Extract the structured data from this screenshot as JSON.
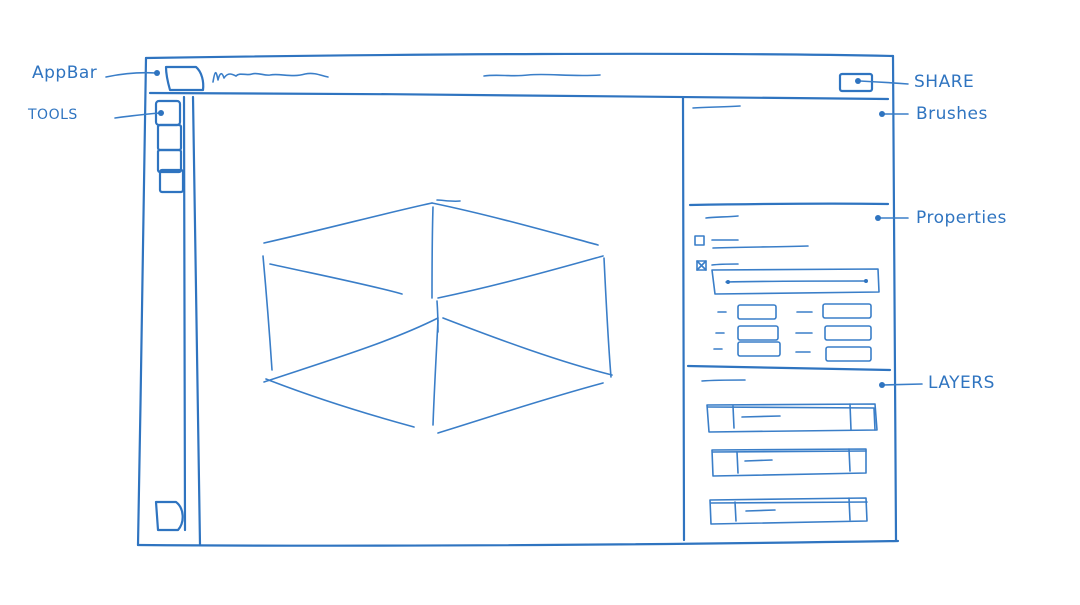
{
  "callouts": {
    "appbar": "AppBar",
    "tools": "TOOLS",
    "share": "SHARE",
    "brushes": "Brushes",
    "properties": "Properties",
    "layers": "LAYERS"
  },
  "colors": {
    "ink": "#2f74c0",
    "background": "#ffffff"
  },
  "properties_panel": {
    "checkboxes": [
      {
        "checked": false
      },
      {
        "checked": true
      }
    ],
    "field_rows": 3
  },
  "layers_panel": {
    "layer_count": 3
  },
  "tools_panel": {
    "tool_count": 4
  }
}
